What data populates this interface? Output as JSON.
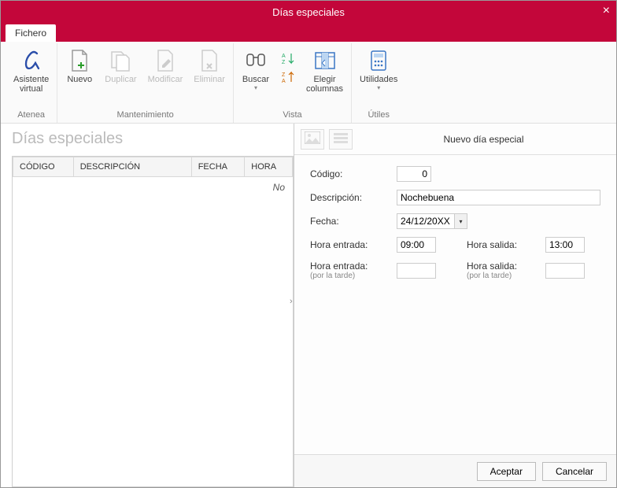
{
  "window": {
    "title": "Días especiales"
  },
  "tab": {
    "label": "Fichero"
  },
  "ribbon": {
    "groups": {
      "atenea": {
        "label": "Atenea",
        "items": {
          "asistente": "Asistente\nvirtual"
        }
      },
      "mantenimiento": {
        "label": "Mantenimiento",
        "items": {
          "nuevo": "Nuevo",
          "duplicar": "Duplicar",
          "modificar": "Modificar",
          "eliminar": "Eliminar"
        }
      },
      "vista": {
        "label": "Vista",
        "items": {
          "buscar": "Buscar",
          "columnas": "Elegir\ncolumnas"
        }
      },
      "utiles": {
        "label": "Útiles",
        "items": {
          "utilidades": "Utilidades"
        }
      }
    }
  },
  "page": {
    "title": "Días especiales"
  },
  "table": {
    "columns": {
      "codigo": "CÓDIGO",
      "descripcion": "DESCRIPCIÓN",
      "fecha": "FECHA",
      "hora": "HORA"
    },
    "norecords_prefix": "No"
  },
  "panel": {
    "title": "Nuevo día especial"
  },
  "form": {
    "codigo_lbl": "Código:",
    "codigo_val": "0",
    "descripcion_lbl": "Descripción:",
    "descripcion_val": "Nochebuena",
    "fecha_lbl": "Fecha:",
    "fecha_val": "24/12/20XX",
    "hentrada_lbl": "Hora entrada:",
    "hentrada_val": "09:00",
    "hsalida_lbl": "Hora salida:",
    "hsalida_val": "13:00",
    "hentrada2_lbl": "Hora entrada:",
    "hentrada2_val": "",
    "hsalida2_lbl": "Hora salida:",
    "hsalida2_val": "",
    "tarde_sub": "(por la tarde)"
  },
  "buttons": {
    "aceptar": "Aceptar",
    "cancelar": "Cancelar"
  }
}
